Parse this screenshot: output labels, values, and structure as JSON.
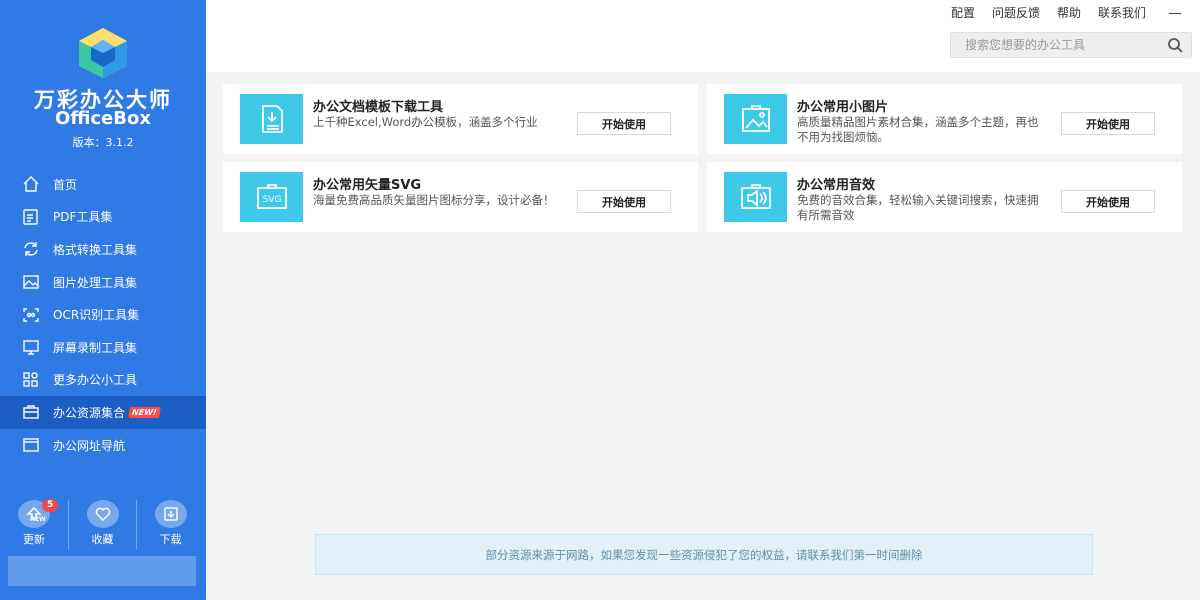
{
  "app": {
    "title": "万彩办公大师",
    "subtitle": "OfficeBox",
    "version": "版本：3.1.2",
    "accent": "#2f7ae5",
    "active_nav": "#1d5ec4",
    "card_icon_color": "#3fc9e8"
  },
  "nav": [
    {
      "label": "首页",
      "icon": "home-icon"
    },
    {
      "label": "PDF工具集",
      "icon": "pdf-icon"
    },
    {
      "label": "格式转换工具集",
      "icon": "convert-icon"
    },
    {
      "label": "图片处理工具集",
      "icon": "image-icon"
    },
    {
      "label": "OCR识别工具集",
      "icon": "ocr-icon"
    },
    {
      "label": "屏幕录制工具集",
      "icon": "monitor-icon"
    },
    {
      "label": "更多办公小工具",
      "icon": "apps-icon"
    },
    {
      "label": "办公资源集合",
      "icon": "briefcase-icon",
      "badge": "NEW!",
      "active": true
    },
    {
      "label": "办公网址导航",
      "icon": "browser-icon"
    }
  ],
  "bottom": {
    "update": {
      "label": "更新",
      "count": "5",
      "mini": "NEW"
    },
    "favorite": {
      "label": "收藏"
    },
    "download": {
      "label": "下载"
    }
  },
  "top": {
    "links": [
      "配置",
      "问题反馈",
      "帮助",
      "联系我们"
    ],
    "search_placeholder": "搜索您想要的办公工具"
  },
  "cards": [
    {
      "title": "办公文档模板下载工具",
      "desc": "上千种Excel,Word办公模板，涵盖多个行业",
      "button": "开始使用",
      "icon": "document-download-icon"
    },
    {
      "title": "办公常用小图片",
      "desc": "高质量精品图片素材合集，涵盖多个主题，再也不用为找图烦恼。",
      "button": "开始使用",
      "icon": "picture-icon"
    },
    {
      "title": "办公常用矢量SVG",
      "desc": "海量免费高品质矢量图片图标分享，设计必备！",
      "button": "开始使用",
      "icon": "svg-icon",
      "icon_text": "SVG"
    },
    {
      "title": "办公常用音效",
      "desc": "免费的音效合集，轻松输入关键词搜索，快速拥有所需音效",
      "button": "开始使用",
      "icon": "speaker-icon"
    }
  ],
  "notice": "部分资源来源于网路，如果您发现一些资源侵犯了您的权益，请联系我们第一时间删除"
}
